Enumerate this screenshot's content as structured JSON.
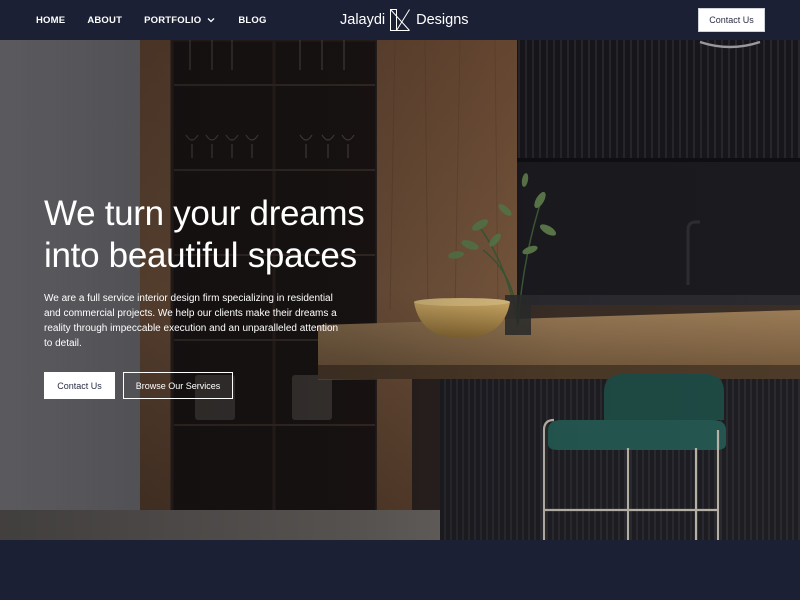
{
  "nav": {
    "links": [
      {
        "label": "HOME"
      },
      {
        "label": "ABOUT"
      },
      {
        "label": "PORTFOLIO"
      },
      {
        "label": "BLOG"
      }
    ],
    "brand_left": "Jalaydi",
    "brand_right": "Designs",
    "cta": "Contact Us"
  },
  "hero": {
    "title_line1": "We turn your dreams",
    "title_line2": "into beautiful spaces",
    "description": "We are a full service interior design firm specializing in residential and commercial projects. We help our clients make their dreams a reality through impeccable execution and an unparalleled attention to detail.",
    "primary_button": "Contact Us",
    "secondary_button": "Browse Our Services"
  },
  "colors": {
    "navy": "#1c2035",
    "white": "#ffffff",
    "button_text": "#2a2e44",
    "stool_green": "#1f4a44"
  },
  "icons": {
    "portfolio_dropdown": "chevron-down-icon",
    "brand_mark": "brand-logo-mark"
  }
}
